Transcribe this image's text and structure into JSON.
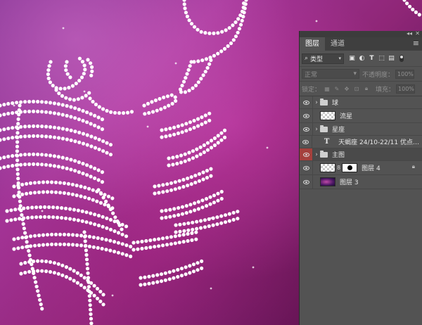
{
  "window": {
    "collapse_glyph": "◂◂",
    "close_glyph": "✕"
  },
  "panel": {
    "tabs": [
      {
        "label": "图层",
        "active": true
      },
      {
        "label": "通道",
        "active": false
      }
    ],
    "menu_icon": "panel-menu-icon",
    "filter": {
      "search_glyph": "⌕",
      "select_value": "类型",
      "icons": [
        "image-filter-icon",
        "adjustment-filter-icon",
        "type-filter-icon",
        "shape-filter-icon",
        "smart-object-filter-icon"
      ]
    },
    "blend": {
      "mode": "正常",
      "opacity_label": "不透明度：",
      "opacity_value": "100%"
    },
    "lock": {
      "label": "锁定：",
      "fill_label": "填充：",
      "fill_value": "100%"
    },
    "layers": [
      {
        "name": "球",
        "kind": "group",
        "visible": true,
        "selected": false
      },
      {
        "name": "流星",
        "kind": "pixel",
        "visible": true,
        "selected": false
      },
      {
        "name": "星座",
        "kind": "group",
        "visible": true,
        "selected": false
      },
      {
        "name": "天蝎座 24/10-22/11 优点：...",
        "kind": "text",
        "visible": true,
        "selected": false
      },
      {
        "name": "主图",
        "kind": "group",
        "visible": true,
        "selected": false,
        "eye_hidden": true
      },
      {
        "name": "图层 4",
        "kind": "pixel-mask",
        "visible": true,
        "selected": false,
        "locked": true
      },
      {
        "name": "图层 3",
        "kind": "image",
        "visible": true,
        "selected": false
      }
    ]
  },
  "colors": {
    "panel_bg": "#535353",
    "selected_eye_cell": "#a5413d",
    "canvas_accent": "#a23597"
  }
}
